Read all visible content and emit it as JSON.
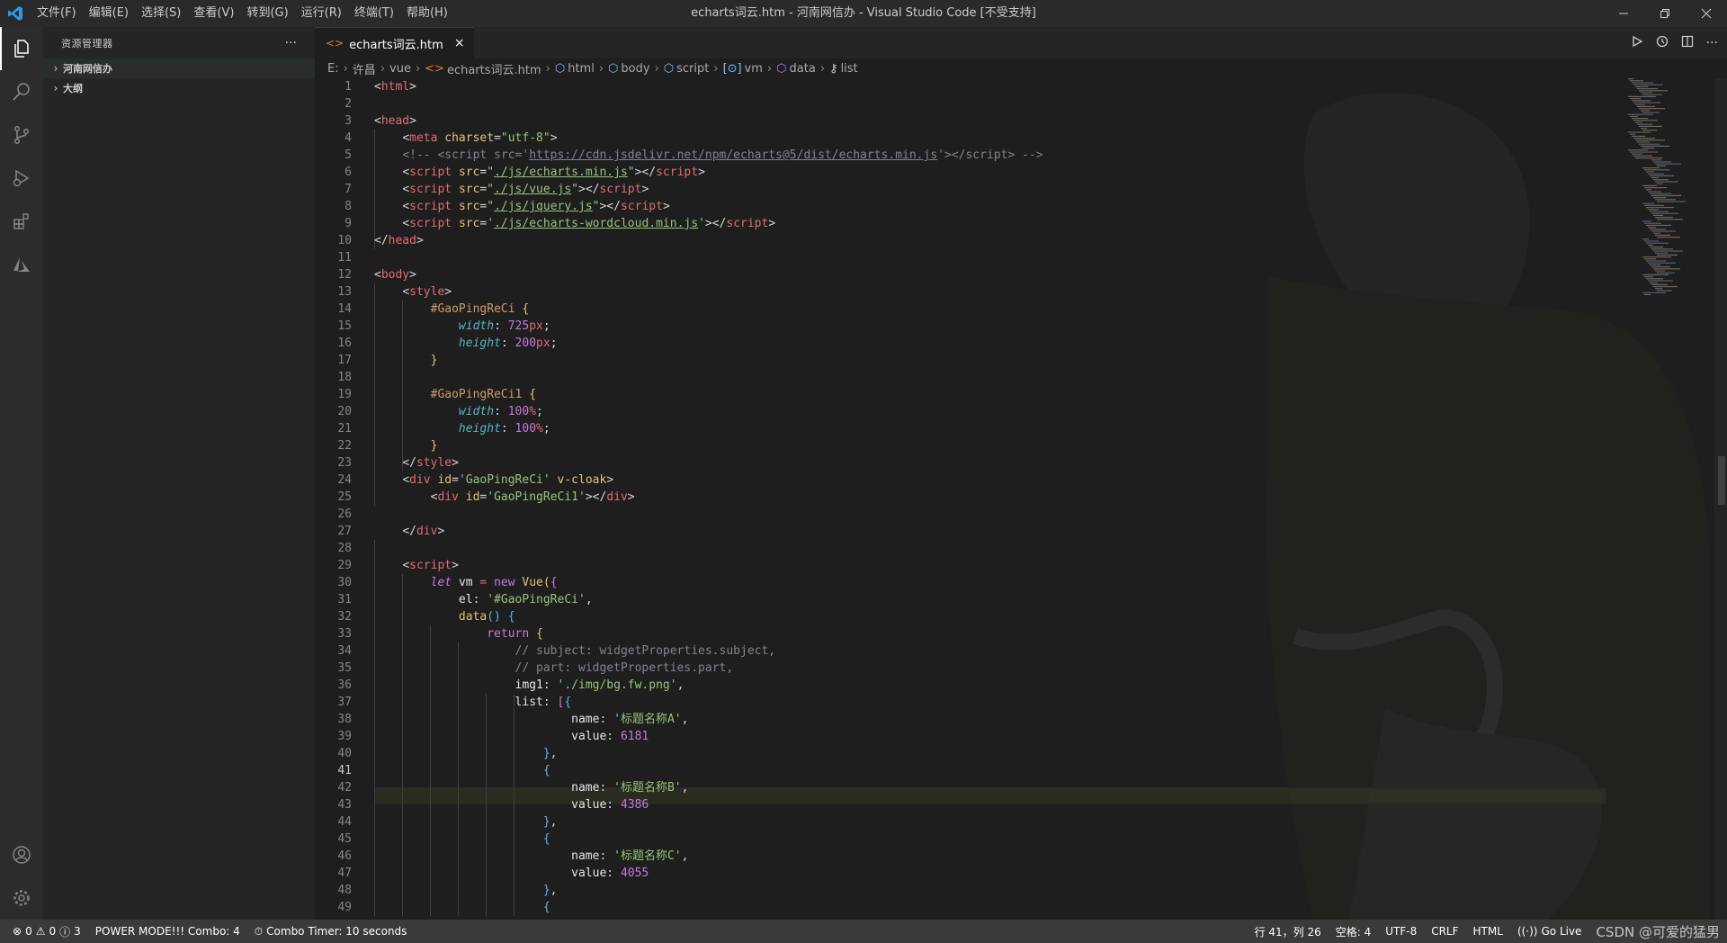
{
  "titlebar": {
    "menu": [
      "文件(F)",
      "编辑(E)",
      "选择(S)",
      "查看(V)",
      "转到(G)",
      "运行(R)",
      "终端(T)",
      "帮助(H)"
    ],
    "title": "echarts词云.htm - 河南网信办 - Visual Studio Code [不受支持]"
  },
  "activitybar": {
    "icons": [
      "explorer-icon",
      "search-icon",
      "source-control-icon",
      "run-debug-icon",
      "extensions-icon",
      "azure-icon"
    ],
    "bottom_icons": [
      "account-icon",
      "settings-gear-icon"
    ]
  },
  "sidebar": {
    "header": "资源管理器",
    "more": "···",
    "sections": [
      {
        "label": "河南网信办"
      },
      {
        "label": "大纲"
      }
    ]
  },
  "tabs": [
    {
      "label": "echarts词云.htm",
      "close": "×"
    }
  ],
  "breadcrumb": [
    "E:",
    "许昌",
    "vue",
    "echarts词云.htm",
    "html",
    "body",
    "script",
    "vm",
    "data",
    "list"
  ],
  "code": {
    "line_numbers": [
      "1",
      "2",
      "3",
      "4",
      "5",
      "6",
      "7",
      "8",
      "9",
      "10",
      "11",
      "12",
      "13",
      "14",
      "15",
      "16",
      "17",
      "18",
      "19",
      "20",
      "21",
      "22",
      "23",
      "24",
      "25",
      "26",
      "27",
      "28",
      "29",
      "30",
      "31",
      "32",
      "33",
      "34",
      "35",
      "36",
      "37",
      "38",
      "39",
      "40",
      "41",
      "42",
      "43",
      "44",
      "45",
      "46",
      "47",
      "48",
      "49"
    ],
    "current_line": 41
  },
  "statusbar": {
    "errors": "0",
    "warnings": "0",
    "info": "3",
    "power_mode": "POWER MODE!!! Combo: 4",
    "combo_timer": "Combo Timer: 10 seconds",
    "cursor": "行 41，列 26",
    "spaces": "空格: 4",
    "encoding": "UTF-8",
    "eol": "CRLF",
    "language": "HTML",
    "golive": "Go Live",
    "watermark": "CSDN @可爱的猛男"
  },
  "colors": {
    "titlebar_bg": "#2a2a2a",
    "activitybar_bg": "#2c2c2c",
    "sidebar_bg": "#252526",
    "editor_bg": "#1e1e1e",
    "statusbar_bg": "#3a3a3a",
    "tag": "#e06c75",
    "string": "#98c379"
  }
}
